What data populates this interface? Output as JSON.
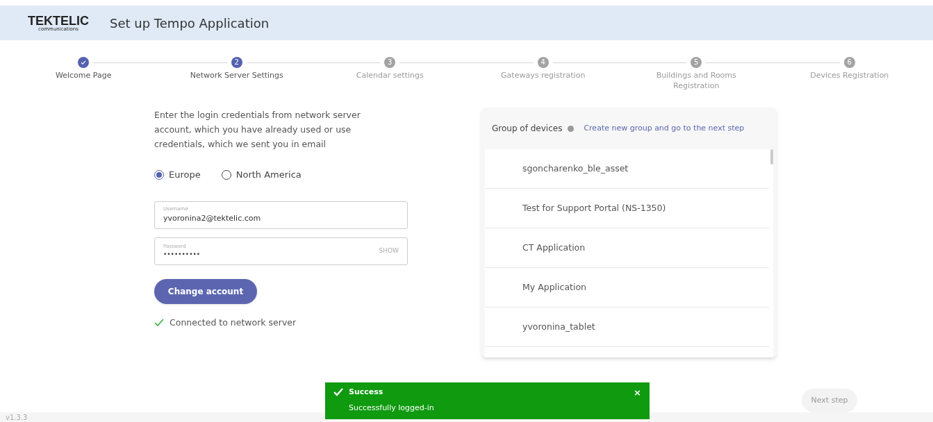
{
  "header": {
    "logo": "TEKTELIC",
    "logo_sub": "communications",
    "title": "Set up Tempo Application"
  },
  "steps": [
    {
      "label": "Welcome Page",
      "kind": "done"
    },
    {
      "number": "2",
      "label": "Network Server Settings",
      "kind": "current"
    },
    {
      "number": "3",
      "label": "Calendar settings",
      "kind": "upcoming"
    },
    {
      "number": "4",
      "label": "Gateways registration",
      "kind": "upcoming"
    },
    {
      "number": "5",
      "label": "Buildings and Rooms Registration",
      "kind": "upcoming"
    },
    {
      "number": "6",
      "label": "Devices Registration",
      "kind": "upcoming"
    }
  ],
  "intro": "Enter the login credentials from network server account, which you have already used or use credentials, which we sent you in email",
  "regions": [
    {
      "label": "Europe",
      "selected": true
    },
    {
      "label": "North America",
      "selected": false
    }
  ],
  "username": {
    "label": "Username",
    "value": "yvoronina2@tektelic.com"
  },
  "password": {
    "label": "Password",
    "value": "••••••••••",
    "toggle": "SHOW"
  },
  "change_button": "Change account",
  "status": "Connected to network server",
  "groups": {
    "title": "Group of devices",
    "link": "Create new group and go to the next step",
    "items": [
      "sgoncharenko_ble_asset",
      "Test for Support Portal (NS-1350)",
      "CT Application",
      "My Application",
      "yvoronina_tablet"
    ]
  },
  "toast": {
    "title": "Success",
    "message": "Successfully logged-in",
    "close": "×"
  },
  "next_button": {
    "label": "Next step",
    "disabled": true
  },
  "version": "v1.3.3"
}
